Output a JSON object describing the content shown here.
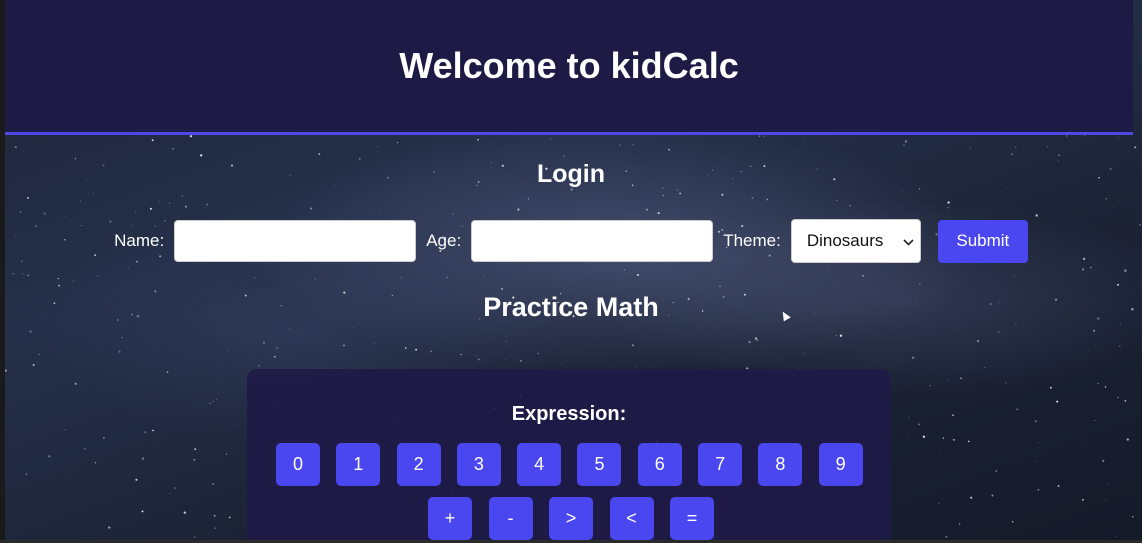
{
  "header": {
    "title": "Welcome to kidCalc"
  },
  "login": {
    "title": "Login",
    "name_label": "Name:",
    "name_value": "",
    "age_label": "Age:",
    "age_value": "",
    "theme_label": "Theme:",
    "theme_selected": "Dinosaurs",
    "submit_label": "Submit"
  },
  "practice": {
    "title": "Practice Math",
    "expression_label": "Expression:",
    "digit_keys": [
      "0",
      "1",
      "2",
      "3",
      "4",
      "5",
      "6",
      "7",
      "8",
      "9"
    ],
    "operator_keys": [
      "+",
      "-",
      ">",
      "<",
      "="
    ]
  },
  "colors": {
    "header_bg": "#1d1a45",
    "accent": "#4a47f0",
    "panel_bg": "#1e1a48"
  },
  "icons": {
    "select_chevron": "chevron-down-icon"
  }
}
